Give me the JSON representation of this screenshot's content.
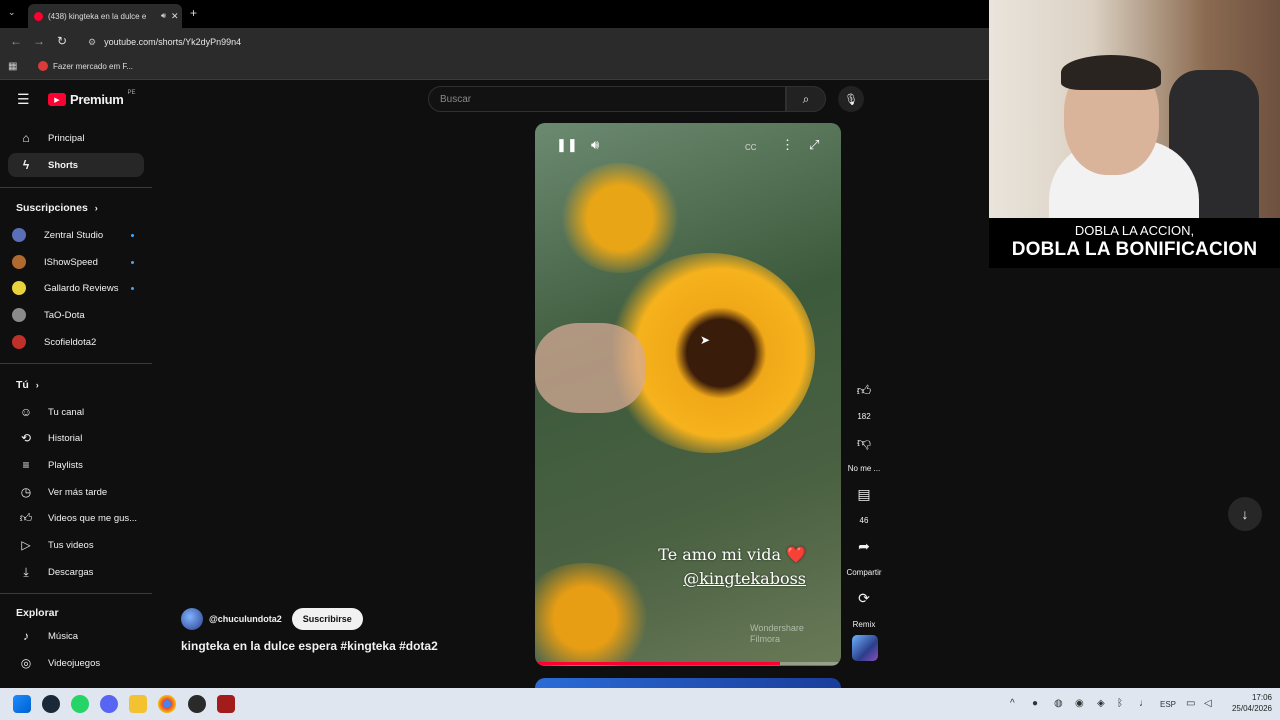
{
  "browser": {
    "tab_title": "(438) kingteka en la dulce e",
    "url": "youtube.com/shorts/Yk2dyPn99n4",
    "bookmark": "Fazer mercado em F..."
  },
  "header": {
    "logo_text": "Premium",
    "logo_badge": "PE",
    "search_placeholder": "Buscar"
  },
  "sidebar": {
    "main": [
      {
        "label": "Principal",
        "icon": "home-icon"
      },
      {
        "label": "Shorts",
        "icon": "shorts-icon"
      }
    ],
    "subscriptions_title": "Suscripciones",
    "subscriptions": [
      {
        "label": "Zentral Studio",
        "color": "#5a6fb8"
      },
      {
        "label": "IShowSpeed",
        "color": "#b06a2f"
      },
      {
        "label": "Gallardo Reviews",
        "color": "#e9d23b"
      },
      {
        "label": "TaO-Dota",
        "color": "#8a8a8a"
      },
      {
        "label": "Scofieldota2",
        "color": "#c0302a"
      }
    ],
    "you_title": "Tú",
    "you": [
      {
        "label": "Tu canal",
        "icon": "channel-icon"
      },
      {
        "label": "Historial",
        "icon": "history-icon"
      },
      {
        "label": "Playlists",
        "icon": "playlists-icon"
      },
      {
        "label": "Ver más tarde",
        "icon": "watch-later-icon"
      },
      {
        "label": "Videos que me gus...",
        "icon": "liked-icon"
      },
      {
        "label": "Tus videos",
        "icon": "your-videos-icon"
      },
      {
        "label": "Descargas",
        "icon": "downloads-icon"
      }
    ],
    "explore_title": "Explorar",
    "explore": [
      {
        "label": "Música",
        "icon": "music-icon"
      },
      {
        "label": "Videojuegos",
        "icon": "gaming-icon"
      }
    ]
  },
  "short": {
    "overlay_line1": "Te amo mi vida ❤️",
    "overlay_line2": "@kingtekaboss",
    "watermark_line1": "Wondershare",
    "watermark_line2": "Filmora",
    "channel": "@chuculundota2",
    "subscribe_label": "Suscribirse",
    "title": "kingteka en la dulce espera #kingteka #dota2",
    "progress": 0.8
  },
  "actions": {
    "likes": "182",
    "dislike": "No me ...",
    "comments": "46",
    "share": "Compartir",
    "remix": "Remix"
  },
  "stream": {
    "banner_line1": "DOBLA LA ACCION,",
    "banner_line2": "DOBLA LA BONIFICACION"
  },
  "taskbar": {
    "lang": "ESP",
    "time": "17:06",
    "date": "25/04/2026"
  }
}
